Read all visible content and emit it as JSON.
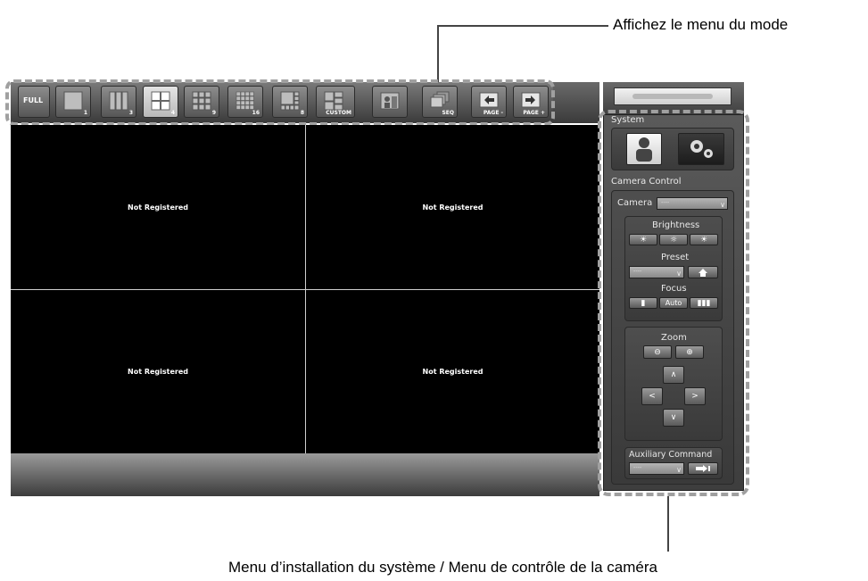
{
  "callouts": {
    "top": "Affichez le menu du mode",
    "bottom": "Menu d’installation du système / Menu de contrôle de la caméra"
  },
  "toolbar": {
    "full_label": "FULL",
    "buttons": [
      {
        "label": "1"
      },
      {
        "label": "3"
      },
      {
        "label": "4"
      },
      {
        "label": "9"
      },
      {
        "label": "16"
      },
      {
        "label": "8"
      },
      {
        "label": "CUSTOM"
      },
      {
        "label": ""
      },
      {
        "label": "SEQ"
      },
      {
        "label": "PAGE -"
      },
      {
        "label": "PAGE +"
      }
    ]
  },
  "grid": {
    "cells": [
      "Not Registered",
      "Not Registered",
      "Not Registered",
      "Not Registered"
    ]
  },
  "panel": {
    "system_label": "System",
    "camera_control_label": "Camera Control",
    "camera_label": "Camera",
    "camera_value": "----",
    "brightness_label": "Brightness",
    "preset_label": "Preset",
    "preset_value": "----",
    "focus_label": "Focus",
    "focus_auto": "Auto",
    "zoom_label": "Zoom",
    "up": "∧",
    "down": "∨",
    "left": "<",
    "right": ">",
    "aux_label": "Auxiliary Command",
    "aux_value": "----"
  }
}
